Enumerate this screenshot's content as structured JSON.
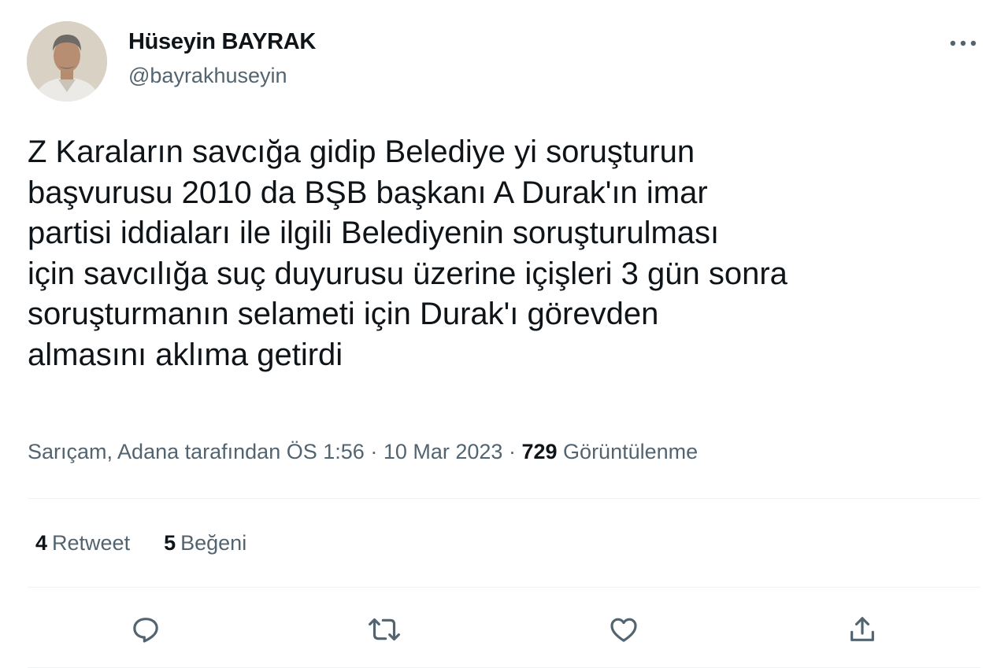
{
  "author": {
    "display_name": "Hüseyin BAYRAK",
    "handle": "@bayrakhuseyin",
    "avatar_icon": "user-avatar"
  },
  "more_icon": "more-horizontal-icon",
  "tweet": {
    "text": "Z Karaların savcığa gidip Belediye yi soruşturun\nbaşvurusu 2010 da BŞB başkanı A Durak'ın imar\npartisi iddiaları ile ilgili Belediyenin soruşturulması\niçin savcılığa suç duyurusu üzerine içişleri 3 gün sonra\nsoruşturmanın selameti için Durak'ı görevden\nalmasını aklıma getirdi"
  },
  "meta": {
    "location": "Sarıçam, Adana tarafından",
    "time": "ÖS 1:56",
    "separator": "·",
    "date": "10 Mar 2023",
    "views_count": "729",
    "views_label": "Görüntülenme"
  },
  "stats": {
    "retweets_count": "4",
    "retweets_label": "Retweet",
    "likes_count": "5",
    "likes_label": "Beğeni"
  },
  "actions": [
    "reply-icon",
    "retweet-icon",
    "like-icon",
    "share-icon"
  ],
  "colors": {
    "text_primary": "#0f1419",
    "text_secondary": "#536471",
    "divider": "#eff3f4"
  }
}
